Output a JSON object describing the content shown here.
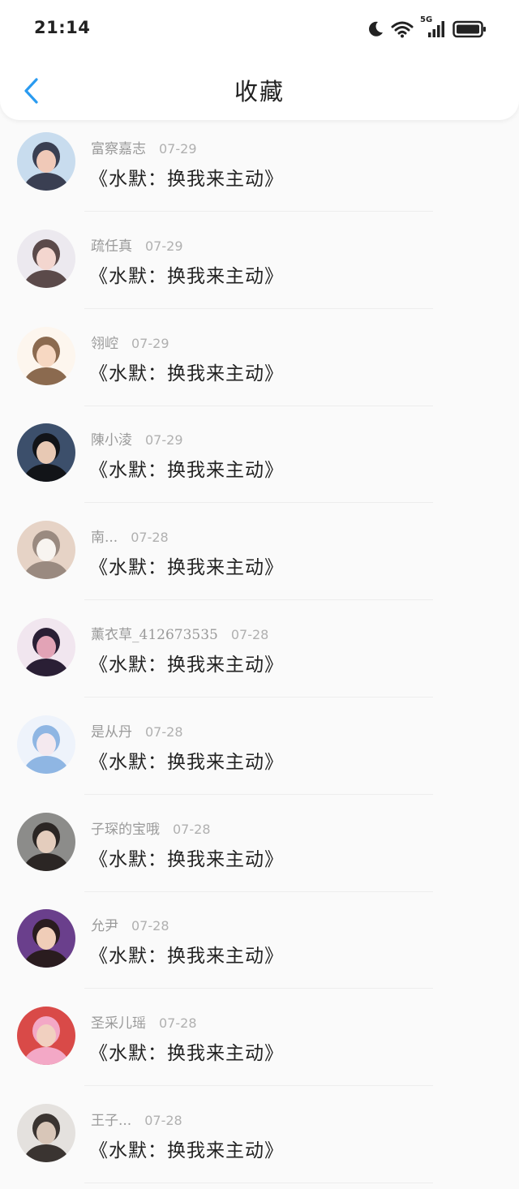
{
  "status_bar": {
    "time": "21:14",
    "icons": [
      "moon-icon",
      "wifi-icon",
      "5g-signal-icon",
      "battery-icon"
    ],
    "network_label": "5G"
  },
  "nav": {
    "title": "收藏",
    "back_icon": "chevron-left-icon",
    "accent_color": "#2a9bf0"
  },
  "items": [
    {
      "name": "富察嘉志",
      "date": "07-29",
      "title": "《水默：换我来主动》",
      "avatar": [
        "#c8dcee",
        "#3a3f52",
        "#f0c9b8"
      ]
    },
    {
      "name": "疏任真",
      "date": "07-29",
      "title": "《水默：换我来主动》",
      "avatar": [
        "#ece9ef",
        "#5b4a4a",
        "#f3d6cf"
      ]
    },
    {
      "name": "翎崆",
      "date": "07-29",
      "title": "《水默：换我来主动》",
      "avatar": [
        "#fdf6ee",
        "#8b6a4f",
        "#f7d8c2"
      ]
    },
    {
      "name": "陳小淩",
      "date": "07-29",
      "title": "《水默：换我来主动》",
      "avatar": [
        "#3c4f6b",
        "#121418",
        "#e8c9b4"
      ]
    },
    {
      "name": "南...",
      "date": "07-28",
      "title": "《水默：换我来主动》",
      "avatar": [
        "#e6d3c6",
        "#9a8a80",
        "#f8f4f0"
      ]
    },
    {
      "name": "薰衣草_412673535",
      "date": "07-28",
      "title": "《水默：换我来主动》",
      "avatar": [
        "#f1e6ef",
        "#2a1f35",
        "#e2a3b6"
      ]
    },
    {
      "name": "是从丹",
      "date": "07-28",
      "title": "《水默：换我来主动》",
      "avatar": [
        "#eef3fb",
        "#8fb6e3",
        "#f4e9ef"
      ]
    },
    {
      "name": "子琛的宝哦",
      "date": "07-28",
      "title": "《水默：换我来主动》",
      "avatar": [
        "#8c8c8a",
        "#2b2624",
        "#e4cdbd"
      ]
    },
    {
      "name": "允尹",
      "date": "07-28",
      "title": "《水默：换我来主动》",
      "avatar": [
        "#6a3f8c",
        "#2a1c1f",
        "#f0cdb8"
      ]
    },
    {
      "name": "圣采儿瑶",
      "date": "07-28",
      "title": "《水默：换我来主动》",
      "avatar": [
        "#d94a48",
        "#f3a8c6",
        "#f1d0c0"
      ]
    },
    {
      "name": "王子...",
      "date": "07-28",
      "title": "《水默：换我来主动》",
      "avatar": [
        "#e4e1de",
        "#3a3431",
        "#d8c6b8"
      ]
    }
  ]
}
